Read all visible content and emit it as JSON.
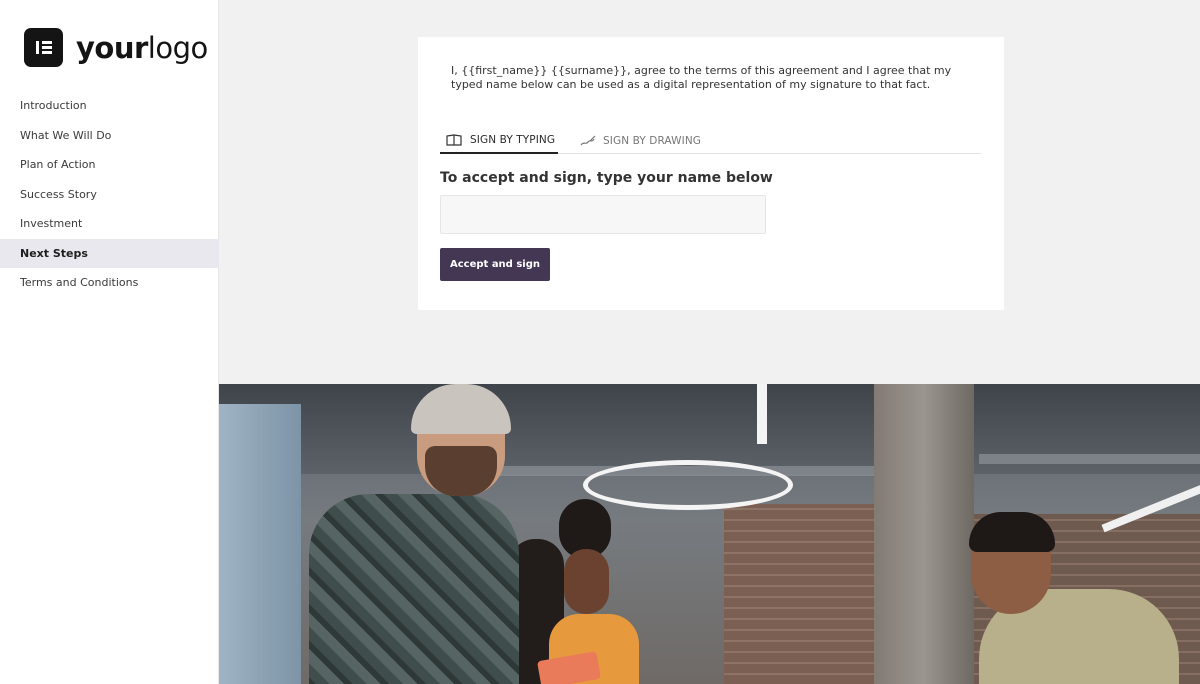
{
  "brand": {
    "logo_text_bold": "your",
    "logo_text_regular": "logo",
    "logo_icon": "elementor-logo-icon"
  },
  "sidebar": {
    "items": [
      {
        "label": "Introduction",
        "active": false
      },
      {
        "label": "What We Will Do",
        "active": false
      },
      {
        "label": "Plan of Action",
        "active": false
      },
      {
        "label": "Success Story",
        "active": false
      },
      {
        "label": "Investment",
        "active": false
      },
      {
        "label": "Next Steps",
        "active": true
      },
      {
        "label": "Terms and Conditions",
        "active": false
      }
    ]
  },
  "signature": {
    "agreement_text": "I, {{first_name}} {{surname}}, agree to the terms of this agreement and I agree that my typed name below can be used as a digital representation of my signature to that fact.",
    "tabs": [
      {
        "label": "SIGN BY TYPING",
        "icon": "keyboard-icon",
        "active": true
      },
      {
        "label": "SIGN BY DRAWING",
        "icon": "signature-pen-icon",
        "active": false
      }
    ],
    "heading": "To accept and sign, type your name below",
    "name_input_value": "",
    "name_input_placeholder": "",
    "accept_button_label": "Accept and sign"
  },
  "colors": {
    "accent_button": "#433754",
    "active_nav_bg": "#e8e8ee",
    "page_bg": "#f1f1f1"
  }
}
